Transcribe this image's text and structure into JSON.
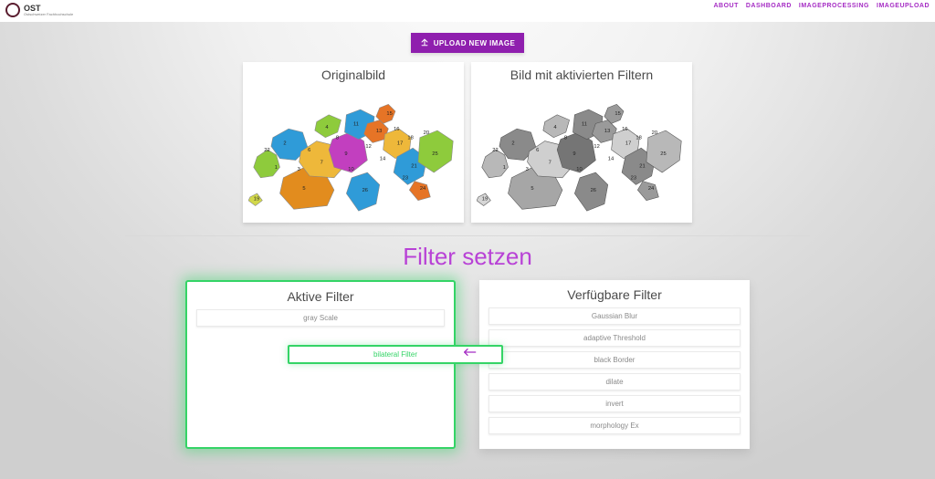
{
  "brand": {
    "name": "OST",
    "sub": "Ostschweizer Fachhochschule"
  },
  "nav": {
    "about": "ABOUT",
    "dashboard": "DASHBOARD",
    "imageprocessing": "IMAGEPROCESSING",
    "imageupload": "IMAGEUPLOAD"
  },
  "upload": {
    "label": "UPLOAD NEW IMAGE"
  },
  "cards": {
    "original": "Originalbild",
    "filtered": "Bild mit aktivierten Filtern"
  },
  "mapLabels": {
    "c1": "1",
    "c2": "2",
    "c3": "3",
    "c4": "4",
    "c5": "5",
    "c6": "6",
    "c7": "7",
    "c8": "8",
    "c9": "9",
    "c10": "10",
    "c11": "11",
    "c12": "12",
    "c13": "13",
    "c14": "14",
    "c15": "15",
    "c16": "16",
    "c17": "17",
    "c18": "18",
    "c19": "19",
    "c20": "20",
    "c21": "21",
    "c22": "22",
    "c23": "23",
    "c24": "24",
    "c25": "25",
    "c26": "26"
  },
  "filterHead": "Filter setzen",
  "panels": {
    "left": "Aktive Filter",
    "right": "Verfügbare Filter"
  },
  "active": {
    "f0": "gray Scale"
  },
  "dragging": "bilateral Filter",
  "available": {
    "f0": "Gaussian Blur",
    "f1": "adaptive Threshold",
    "f2": "black Border",
    "f3": "dilate",
    "f4": "invert",
    "f5": "morphology Ex"
  }
}
